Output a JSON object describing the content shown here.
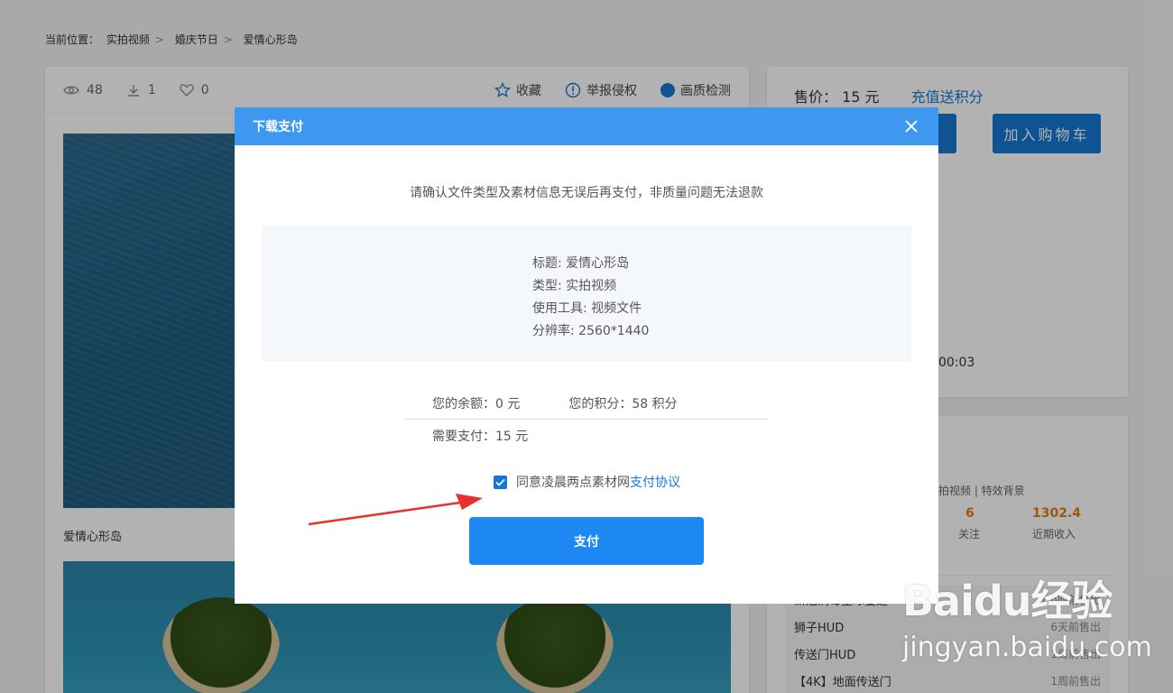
{
  "breadcrumb": {
    "prefix": "当前位置：",
    "items": [
      "实拍视频",
      "婚庆节日",
      "爱情心形岛"
    ],
    "sep": ">"
  },
  "stats": {
    "views": "48",
    "downloads": "1",
    "likes": "0"
  },
  "actions": {
    "favorite": "收藏",
    "report": "举报侵权",
    "quality": "画质检测"
  },
  "video_title": "爱情心形岛",
  "price_panel": {
    "price_label": "售价：",
    "price_value": "15 元",
    "recharge_link": "充值送积分",
    "add_cart": "加入购物车",
    "time_fragment": "00:03"
  },
  "author": {
    "categories": "拍视频 | 特效背景",
    "follow_count": "6",
    "follow_label": "关注",
    "income_value": "1302.4",
    "income_label": "近期收入",
    "sales": [
      {
        "name": "新冠病毒全球蔓延",
        "time": "1小时前售出"
      },
      {
        "name": "狮子HUD",
        "time": "6天前售出"
      },
      {
        "name": "传送门HUD",
        "time": "1周前售出"
      },
      {
        "name": "【4K】地面传送门",
        "time": "1周前售出"
      }
    ]
  },
  "modal": {
    "title": "下载支付",
    "notice": "请确认文件类型及素材信息无误后再支付，非质量问题无法退款",
    "info": {
      "title": "标题: 爱情心形岛",
      "type": "类型: 实拍视频",
      "tool": "使用工具: 视频文件",
      "resolution": "分辨率: 2560*1440"
    },
    "balance": "您的余额：0 元",
    "points": "您的积分：58 积分",
    "need_pay": "需要支付：15 元",
    "agree_text": "同意凌晨两点素材网",
    "agree_link": "支付协议",
    "pay_button": "支付"
  },
  "watermark": {
    "logo": "Baidu经验",
    "url": "jingyan.baidu.com"
  },
  "colors": {
    "accent": "#1677d2",
    "modal_header": "#3f98f0",
    "pay_button": "#1e88f2",
    "arrow": "#e8312f"
  }
}
